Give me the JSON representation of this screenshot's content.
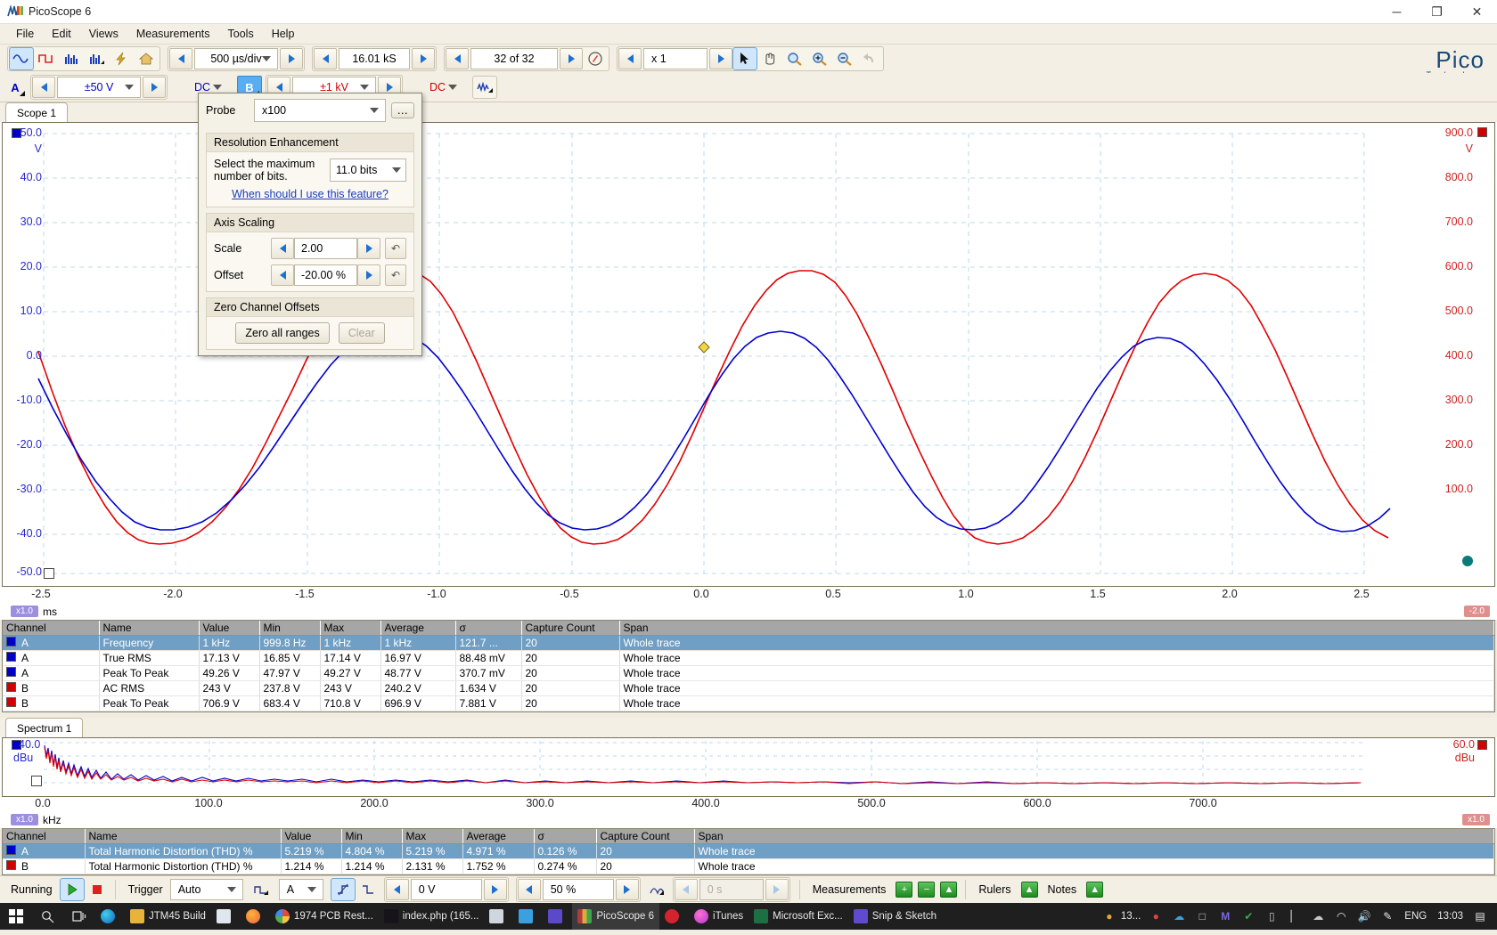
{
  "window": {
    "title": "PicoScope 6",
    "minimize": "─",
    "maximize": "❐",
    "close": "✕"
  },
  "menu": [
    {
      "label": "File",
      "accel": "F"
    },
    {
      "label": "Edit",
      "accel": "E"
    },
    {
      "label": "Views",
      "accel": "V"
    },
    {
      "label": "Measurements",
      "accel": "M"
    },
    {
      "label": "Tools",
      "accel": "T"
    },
    {
      "label": "Help",
      "accel": "H"
    }
  ],
  "toolbar": {
    "view_buttons": [
      {
        "name": "scope-view-icon",
        "label": "∿",
        "selected": true
      },
      {
        "name": "square-wave-icon",
        "label": "⊓",
        "selected": false
      },
      {
        "name": "spectrum-view-icon",
        "label": "▐▐",
        "selected": false
      },
      {
        "name": "persistence-view-icon",
        "label": "▐▐",
        "selected": false
      }
    ],
    "lightning_icon": "⚡",
    "home_icon": "⌂",
    "timebase": "500 µs/div",
    "samples": "16.01 kS",
    "buffer": "32 of 32",
    "zoom_factor": "x 1",
    "pointer_tools": [
      {
        "name": "pointer-tool-icon",
        "selected": true
      },
      {
        "name": "hand-pan-icon",
        "selected": false
      },
      {
        "name": "zoom-window-icon",
        "selected": false
      },
      {
        "name": "zoom-in-icon",
        "selected": false
      },
      {
        "name": "zoom-out-icon",
        "selected": false
      },
      {
        "name": "undo-zoom-icon",
        "selected": false
      }
    ]
  },
  "channelbar": {
    "channel_a": {
      "id": "A",
      "range": "±50 V",
      "coupling": "DC",
      "color": "#0000c8"
    },
    "channel_b": {
      "id": "B",
      "range": "±1 kV",
      "coupling": "DC",
      "color": "#d20000",
      "selected": true
    },
    "math_channel_icon": "∿"
  },
  "brand": {
    "name": "Pico",
    "tagline": "Technology"
  },
  "popup": {
    "probe_label": "Probe",
    "probe_value": "x100",
    "probe_more": "…",
    "resolution": {
      "title": "Resolution Enhancement",
      "prompt_line1": "Select the maximum",
      "prompt_line2": "number of bits.",
      "bits_value": "11.0 bits",
      "help_link": "When should I use this feature?"
    },
    "axis_scaling": {
      "title": "Axis Scaling",
      "scale_label": "Scale",
      "scale_value": "2.00",
      "offset_label": "Offset",
      "offset_value": "-20.00 %",
      "revert_icon": "↶"
    },
    "zero_offsets": {
      "title": "Zero Channel Offsets",
      "zero_all_label": "Zero all ranges",
      "clear_label": "Clear"
    }
  },
  "scope": {
    "tab_label": "Scope 1",
    "x_unit": "ms",
    "x_multiplier": "x1.0",
    "left_unit": "V",
    "right_unit": "V",
    "y_left_ticks": [
      "50.0",
      "40.0",
      "30.0",
      "20.0",
      "10.0",
      "0.0",
      "-10.0",
      "-20.0",
      "-30.0",
      "-40.0",
      "-50.0"
    ],
    "y_right_ticks": [
      "900.0",
      "800.0",
      "700.0",
      "600.0",
      "500.0",
      "400.0",
      "300.0",
      "200.0",
      "100.0"
    ],
    "x_ticks": [
      "-2.5",
      "-2.0",
      "-1.5",
      "-1.0",
      "-0.5",
      "0.0",
      "0.5",
      "1.0",
      "1.5",
      "2.0",
      "2.5"
    ],
    "right_offset_badge": "-2.0"
  },
  "chart_data": {
    "type": "line",
    "title": "Scope 1",
    "xlabel": "ms",
    "ylabel": "V",
    "xlim": [
      -2.5,
      2.5
    ],
    "ylim_left": [
      -50,
      50
    ],
    "ylim_right": [
      100,
      900
    ],
    "grid": true,
    "series": [
      {
        "name": "A",
        "color": "#0000c8",
        "axis": "left",
        "waveform": "clipped-sine",
        "frequency_khz": 1,
        "amplitude_v": 24.6,
        "offset_v": 0
      },
      {
        "name": "B",
        "color": "#d20000",
        "axis": "left",
        "waveform": "clipped-sine",
        "frequency_khz": 1,
        "amplitude_v": 33.0,
        "offset_v": 0
      }
    ]
  },
  "scope_measurements": {
    "columns": [
      "Channel",
      "Name",
      "Value",
      "Min",
      "Max",
      "Average",
      "σ",
      "Capture Count",
      "Span"
    ],
    "rows": [
      {
        "selected": true,
        "swatch": "#0000c8",
        "cells": [
          "A",
          "Frequency",
          "1 kHz",
          "999.8 Hz",
          "1 kHz",
          "1 kHz",
          "121.7 ...",
          "20",
          "Whole trace"
        ]
      },
      {
        "selected": false,
        "swatch": "#0000c8",
        "cells": [
          "A",
          "True RMS",
          "17.13 V",
          "16.85 V",
          "17.14 V",
          "16.97 V",
          "88.48 mV",
          "20",
          "Whole trace"
        ]
      },
      {
        "selected": false,
        "swatch": "#0000c8",
        "cells": [
          "A",
          "Peak To Peak",
          "49.26 V",
          "47.97 V",
          "49.27 V",
          "48.77 V",
          "370.7 mV",
          "20",
          "Whole trace"
        ]
      },
      {
        "selected": false,
        "swatch": "#d20000",
        "cells": [
          "B",
          "AC RMS",
          "243 V",
          "237.8 V",
          "243 V",
          "240.2 V",
          "1.634 V",
          "20",
          "Whole trace"
        ]
      },
      {
        "selected": false,
        "swatch": "#d20000",
        "cells": [
          "B",
          "Peak To Peak",
          "706.9 V",
          "683.4 V",
          "710.8 V",
          "696.9 V",
          "7.881 V",
          "20",
          "Whole trace"
        ]
      }
    ]
  },
  "spectrum": {
    "tab_label": "Spectrum 1",
    "left_top": "40.0",
    "left_unit": "dBu",
    "right_top": "60.0",
    "right_unit": "dBu",
    "x_unit": "kHz",
    "x_multiplier": "x1.0",
    "x_right_badge": "x1.0",
    "x_ticks": [
      "0.0",
      "100.0",
      "200.0",
      "300.0",
      "400.0",
      "500.0",
      "600.0",
      "700.0"
    ]
  },
  "spectrum_measurements": {
    "columns": [
      "Channel",
      "Name",
      "Value",
      "Min",
      "Max",
      "Average",
      "σ",
      "Capture Count",
      "Span"
    ],
    "rows": [
      {
        "selected": true,
        "swatch": "#0000c8",
        "cells": [
          "A",
          "Total Harmonic Distortion (THD) %",
          "5.219 %",
          "4.804 %",
          "5.219 %",
          "4.971 %",
          "0.126 %",
          "20",
          "Whole trace"
        ]
      },
      {
        "selected": false,
        "swatch": "#d20000",
        "cells": [
          "B",
          "Total Harmonic Distortion (THD) %",
          "1.214 %",
          "1.214 %",
          "2.131 %",
          "1.752 %",
          "0.274 %",
          "20",
          "Whole trace"
        ]
      }
    ]
  },
  "statusbar": {
    "running_label": "Running",
    "play_icon": "▶",
    "stop_icon": "■",
    "trigger_label": "Trigger",
    "trigger_mode": "Auto",
    "trigger_source": "A",
    "trigger_level": "0 V",
    "trigger_percent": "50 %",
    "pretrigger_time": "0 s",
    "measurements_label": "Measurements",
    "rulers_label": "Rulers",
    "notes_label": "Notes",
    "add_icon": "+",
    "remove_icon": "−",
    "expand_icon": "▲"
  },
  "taskbar": {
    "start_icon": "⊞",
    "search_icon": "⚲",
    "taskview_icon": "▣",
    "items": [
      {
        "label": "",
        "icon_name": "edge-icon",
        "color": "#2b8fd6",
        "active": false
      },
      {
        "label": "JTM45 Build",
        "icon_name": "folder-icon",
        "color": "#e8b33c",
        "active": false
      },
      {
        "label": "",
        "icon_name": "store-icon",
        "color": "#dfe6ee",
        "active": false
      },
      {
        "label": "",
        "icon_name": "firefox-icon",
        "color": "#e9673c",
        "active": false
      },
      {
        "label": "1974 PCB Rest...",
        "icon_name": "chrome-icon",
        "color": "#4caf50",
        "active": false
      },
      {
        "label": "index.php (165...",
        "icon_name": "tubeamp-icon",
        "color": "#e040a0",
        "active": false
      },
      {
        "label": "",
        "icon_name": "notepad-icon",
        "color": "#cfd6dd",
        "active": false
      },
      {
        "label": "",
        "icon_name": "mail-icon",
        "color": "#3aa0e0",
        "active": false
      },
      {
        "label": "",
        "icon_name": "amazon-music-icon",
        "color": "#5a49c8",
        "active": false
      },
      {
        "label": "PicoScope 6",
        "icon_name": "picoscope-icon",
        "color": "#b33a3a",
        "active": true
      },
      {
        "label": "",
        "icon_name": "opera-icon",
        "color": "#d4232e",
        "active": false
      },
      {
        "label": "iTunes",
        "icon_name": "itunes-icon",
        "color": "#e04a9e",
        "active": false
      },
      {
        "label": "Microsoft Exc...",
        "icon_name": "excel-icon",
        "color": "#1d7044",
        "active": false
      },
      {
        "label": "Snip & Sketch",
        "icon_name": "snip-sketch-icon",
        "color": "#5e4bd0",
        "active": false
      }
    ],
    "tray": [
      {
        "name": "drop-icon",
        "glyph": "●",
        "color": "#e8a33d"
      },
      {
        "name": "battery-percent-label",
        "glyph": "13...",
        "color": "#e8e8e8"
      },
      {
        "name": "colorful-icon",
        "glyph": "●",
        "color": "#d64545"
      },
      {
        "name": "onedrive-icon",
        "glyph": "☁",
        "color": "#3aa0e0"
      },
      {
        "name": "camera-icon",
        "glyph": "□",
        "color": "#c8c8c8"
      },
      {
        "name": "monday-icon",
        "glyph": "M",
        "color": "#5a49c8"
      },
      {
        "name": "shield-icon",
        "glyph": "✔",
        "color": "#3aa84a"
      },
      {
        "name": "phone-icon",
        "glyph": "▯",
        "color": "#c8c8c8"
      },
      {
        "name": "usb-icon",
        "glyph": "▏",
        "color": "#c8c8c8"
      },
      {
        "name": "cloud-icon",
        "glyph": "☁",
        "color": "#c8c8c8"
      },
      {
        "name": "wifi-icon",
        "glyph": "◠",
        "color": "#e8e8e8"
      },
      {
        "name": "volume-icon",
        "glyph": "🔊",
        "color": "#e8e8e8"
      },
      {
        "name": "pen-icon",
        "glyph": "✎",
        "color": "#e8e8e8"
      }
    ],
    "language": "ENG",
    "clock": "13:03",
    "action_center_icon": "▤"
  }
}
